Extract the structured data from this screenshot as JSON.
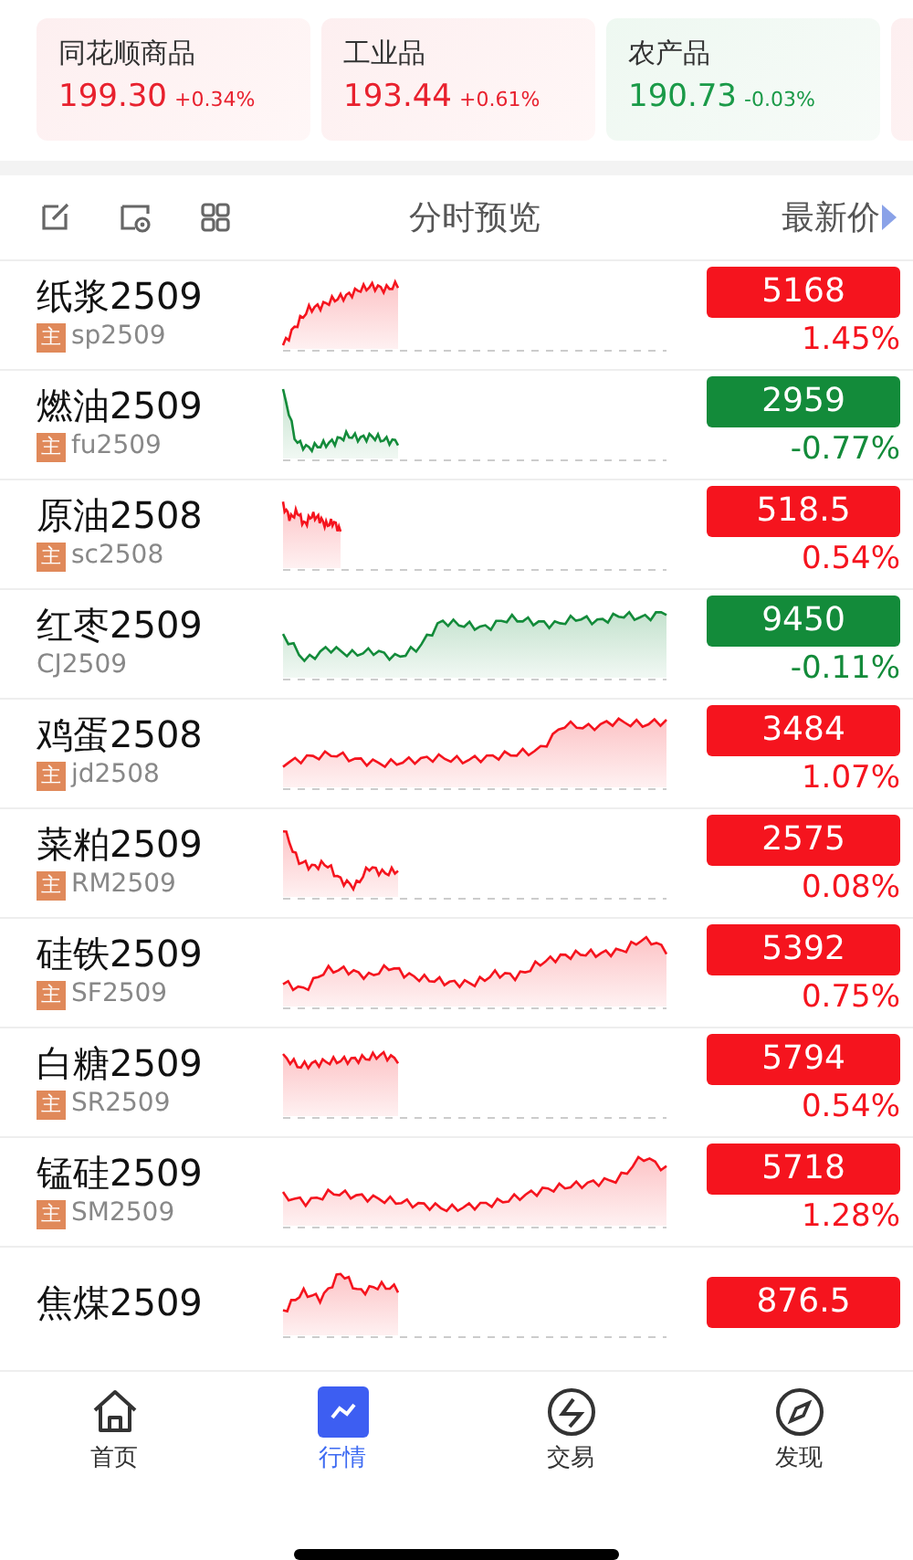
{
  "index_cards": [
    {
      "name": "同花顺商品",
      "value": "199.30",
      "change": "+0.34%",
      "color": "#e8212e"
    },
    {
      "name": "工业品",
      "value": "193.44",
      "change": "+0.61%",
      "color": "#e8212e"
    },
    {
      "name": "农产品",
      "value": "190.73",
      "change": "-0.03%",
      "color": "#1a9a48"
    }
  ],
  "list_header": {
    "chart_label": "分时预览",
    "price_label": "最新价"
  },
  "quotes": [
    {
      "name": "纸浆2509",
      "tag": "主",
      "code": "sp2509",
      "price": "5168",
      "change": "1.45%",
      "color": "#f5141e"
    },
    {
      "name": "燃油2509",
      "tag": "主",
      "code": "fu2509",
      "price": "2959",
      "change": "-0.77%",
      "color": "#138b3a"
    },
    {
      "name": "原油2508",
      "tag": "主",
      "code": "sc2508",
      "price": "518.5",
      "change": "0.54%",
      "color": "#f5141e"
    },
    {
      "name": "红枣2509",
      "code": "CJ2509",
      "price": "9450",
      "change": "-0.11%",
      "color": "#138b3a"
    },
    {
      "name": "鸡蛋2508",
      "tag": "主",
      "code": "jd2508",
      "price": "3484",
      "change": "1.07%",
      "color": "#f5141e"
    },
    {
      "name": "菜粕2509",
      "tag": "主",
      "code": "RM2509",
      "price": "2575",
      "change": "0.08%",
      "color": "#f5141e"
    },
    {
      "name": "硅铁2509",
      "tag": "主",
      "code": "SF2509",
      "price": "5392",
      "change": "0.75%",
      "color": "#f5141e"
    },
    {
      "name": "白糖2509",
      "tag": "主",
      "code": "SR2509",
      "price": "5794",
      "change": "0.54%",
      "color": "#f5141e"
    },
    {
      "name": "锰硅2509",
      "tag": "主",
      "code": "SM2509",
      "price": "5718",
      "change": "1.28%",
      "color": "#f5141e"
    },
    {
      "name": "焦煤2509",
      "price": "876.5",
      "color": "#f5141e"
    }
  ],
  "tab_bar": [
    {
      "label": "首页",
      "selected": false
    },
    {
      "label": "行情",
      "selected": true
    },
    {
      "label": "交易",
      "selected": false
    },
    {
      "label": "发现",
      "selected": false
    }
  ]
}
